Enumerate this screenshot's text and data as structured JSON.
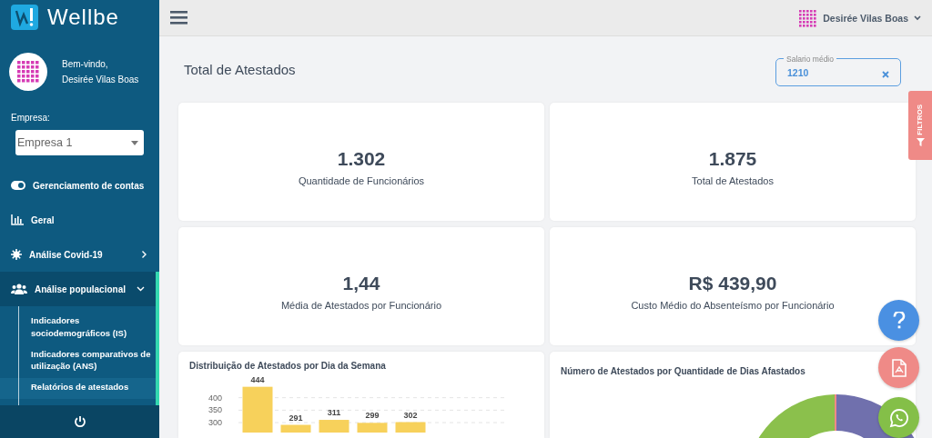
{
  "sidebar": {
    "brand": "Wellbe",
    "welcome": "Bem-vindo,",
    "user_name": "Desirée Vilas Boas",
    "company_label": "Empresa:",
    "company_select": {
      "value": "Empresa 1"
    },
    "menu": [
      {
        "label": "Gerenciamento de contas",
        "kind": "link",
        "selected": false
      },
      {
        "label": "Geral",
        "kind": "link",
        "selected": false
      },
      {
        "label": "Análise Covid-19",
        "kind": "group",
        "selected": false,
        "expanded": false
      },
      {
        "label": "Análise populacional",
        "kind": "group",
        "selected": true,
        "expanded": true,
        "children": [
          {
            "label": "Indicadores sociodemográficos (IS)",
            "selected": false
          },
          {
            "label": "Indicadores comparativos de utilização (ANS)",
            "selected": false
          },
          {
            "label": "Relatórios de atestados",
            "selected": true
          }
        ]
      }
    ]
  },
  "topbar": {
    "user_name": "Desirée Vilas Boas"
  },
  "header": {
    "title": "Total de Atestados",
    "salary_field": {
      "label": "Salario médio",
      "value": "1210"
    }
  },
  "filters_tab": {
    "label": "FILTROS"
  },
  "stats": [
    {
      "value": "1.302",
      "label": "Quantidade de Funcionários"
    },
    {
      "value": "1.875",
      "label": "Total de Atestados"
    },
    {
      "value": "1,44",
      "label": "Média de Atestados por Funcionário"
    },
    {
      "value": "R$ 439,90",
      "label": "Custo Médio do Absenteísmo por Funcionário"
    }
  ],
  "bar_card": {
    "chart_data": {
      "type": "bar",
      "title": "Distribuição de Atestados por Dia da Semana",
      "values": [
        444,
        291,
        311,
        299,
        302,
        null,
        null
      ],
      "ylim": [
        260,
        450
      ],
      "yticks": [
        300,
        350,
        400
      ],
      "grid": true,
      "data_labels": true
    }
  },
  "donut_card": {
    "title": "Número de Atestados por Quantidade de Dias Afastados"
  }
}
